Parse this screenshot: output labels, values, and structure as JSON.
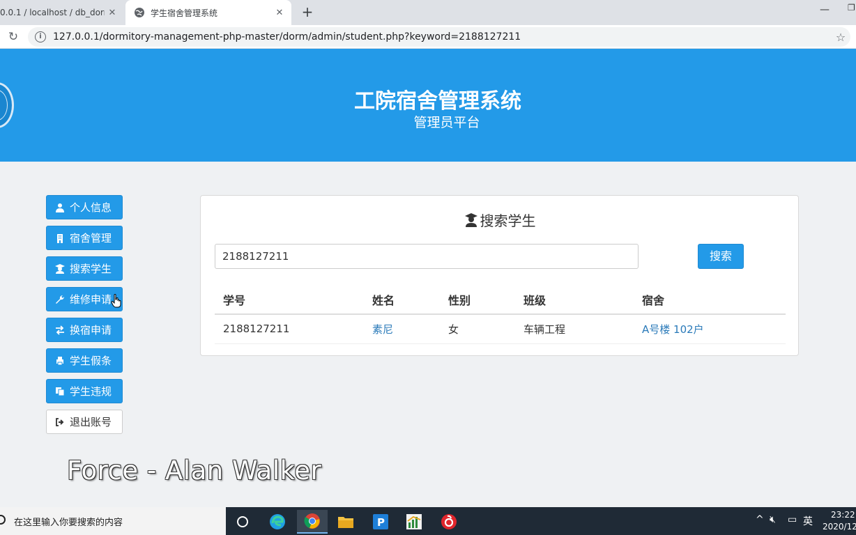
{
  "browser": {
    "tabs": [
      {
        "title": "0.0.1 / localhost / db_dorm",
        "active": false
      },
      {
        "title": "学生宿舍管理系统",
        "active": true
      }
    ],
    "url": "127.0.0.1/dormitory-management-php-master/dorm/admin/student.php?keyword=2188127211",
    "new_tab_label": "+",
    "close_glyph": "✕"
  },
  "header": {
    "title": "工院宿舍管理系统",
    "subtitle": "管理员平台"
  },
  "sidebar": {
    "items": [
      {
        "label": "个人信息",
        "icon": "user-icon"
      },
      {
        "label": "宿舍管理",
        "icon": "building-icon"
      },
      {
        "label": "搜索学生",
        "icon": "student-icon"
      },
      {
        "label": "维修申请",
        "icon": "wrench-icon"
      },
      {
        "label": "换宿申请",
        "icon": "exchange-icon"
      },
      {
        "label": "学生假条",
        "icon": "print-icon"
      },
      {
        "label": "学生违规",
        "icon": "copy-icon"
      },
      {
        "label": "退出账号",
        "icon": "logout-icon"
      }
    ]
  },
  "search": {
    "title": "搜索学生",
    "value": "2188127211",
    "button_label": "搜索"
  },
  "table": {
    "headers": [
      "学号",
      "姓名",
      "性别",
      "班级",
      "宿舍"
    ],
    "rows": [
      [
        "2188127211",
        "素尼",
        "女",
        "车辆工程",
        "A号楼 102户"
      ]
    ]
  },
  "overlay": {
    "lyric": "Force - Alan Walker"
  },
  "taskbar": {
    "search_placeholder": "在这里输入你要搜索的内容",
    "ime": "英",
    "time": "23:22",
    "date": "2020/12"
  },
  "colors": {
    "accent": "#239ae8",
    "link": "#2a7ab9"
  }
}
